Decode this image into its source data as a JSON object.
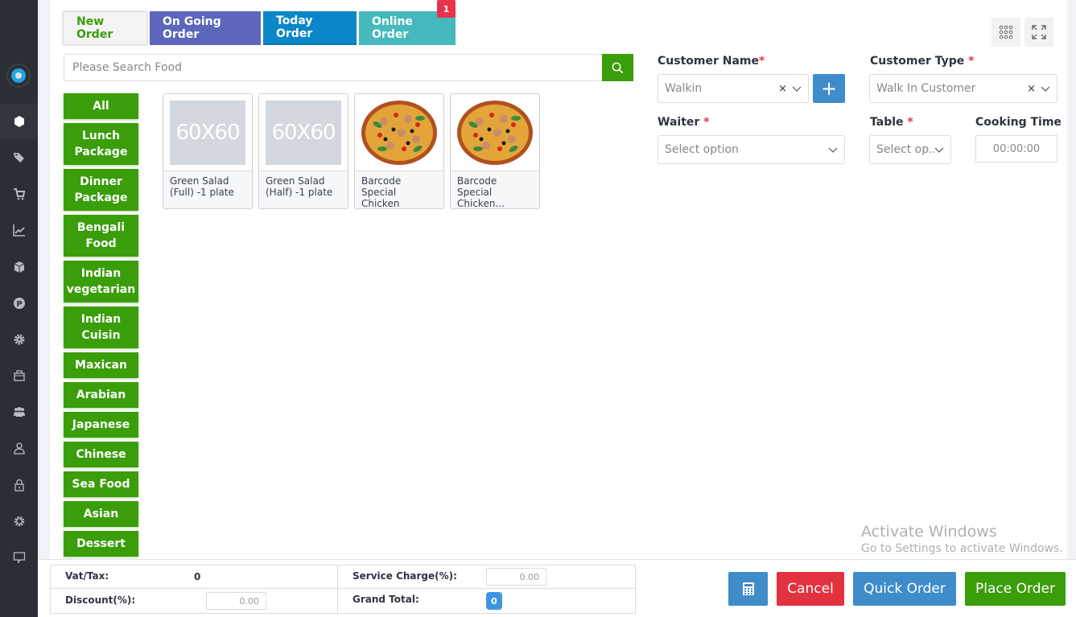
{
  "sidebar": {
    "items": [
      {
        "icon": "dashboard-icon",
        "active": true
      },
      {
        "icon": "tags-icon"
      },
      {
        "icon": "cart-icon"
      },
      {
        "icon": "chart-line-icon"
      },
      {
        "icon": "cube-icon"
      },
      {
        "icon": "parking-icon"
      },
      {
        "icon": "cog-icon"
      },
      {
        "icon": "briefcase-icon"
      },
      {
        "icon": "users-icon"
      },
      {
        "icon": "user-icon"
      },
      {
        "icon": "lock-icon"
      },
      {
        "icon": "settings-icon"
      },
      {
        "icon": "chat-icon"
      }
    ]
  },
  "tabs": {
    "new_order": "New Order",
    "ongoing_order": "On Going Order",
    "today_order": "Today Order",
    "online_order": "Online Order",
    "online_badge": "1"
  },
  "search": {
    "placeholder": "Please Search Food"
  },
  "categories": [
    "All",
    "Lunch Package",
    "Dinner Package",
    "Bengali Food",
    "Indian vegetarian",
    "Indian Cuisin",
    "Maxican",
    "Arabian",
    "Japanese",
    "Chinese",
    "Sea Food",
    "Asian",
    "Dessert"
  ],
  "foods": [
    {
      "name": "Green Salad (Full) -1 plate",
      "image": "placeholder",
      "placeholder_text": "60X60"
    },
    {
      "name": "Green Salad (Half) -1 plate",
      "image": "placeholder",
      "placeholder_text": "60X60"
    },
    {
      "name": "Barcode Special Chicken (Large)",
      "image": "pizza"
    },
    {
      "name": "Barcode Special Chicken...",
      "image": "pizza"
    }
  ],
  "form": {
    "customer_name_label": "Customer Name",
    "customer_name_value": "Walkin",
    "customer_type_label": "Customer Type",
    "customer_type_value": "Walk In Customer",
    "waiter_label": "Waiter",
    "waiter_placeholder": "Select option",
    "table_label": "Table",
    "table_placeholder": "Select op...",
    "cooking_time_label": "Cooking Time",
    "cooking_time_value": "00:00:00",
    "required_mark": "*",
    "clear_mark": "×",
    "add_customer_label": "+"
  },
  "totals": {
    "vat_label": "Vat/Tax:",
    "vat_value": "0",
    "service_charge_label": "Service Charge(%):",
    "service_charge_value": "0.00",
    "discount_label": "Discount(%):",
    "discount_value": "0.00",
    "grand_total_label": "Grand Total:",
    "grand_total_value": "0"
  },
  "actions": {
    "cancel": "Cancel",
    "quick_order": "Quick Order",
    "place_order": "Place Order"
  },
  "colors": {
    "green": "#3a9d0a",
    "ongoing": "#5c67bb",
    "today": "#0a87c9",
    "online": "#45b9bd",
    "badge_red": "#e8334a",
    "blue": "#3f8ccb",
    "cancel_red": "#e3323f"
  },
  "watermark": {
    "line1": "Activate Windows",
    "line2": "Go to Settings to activate Windows."
  }
}
